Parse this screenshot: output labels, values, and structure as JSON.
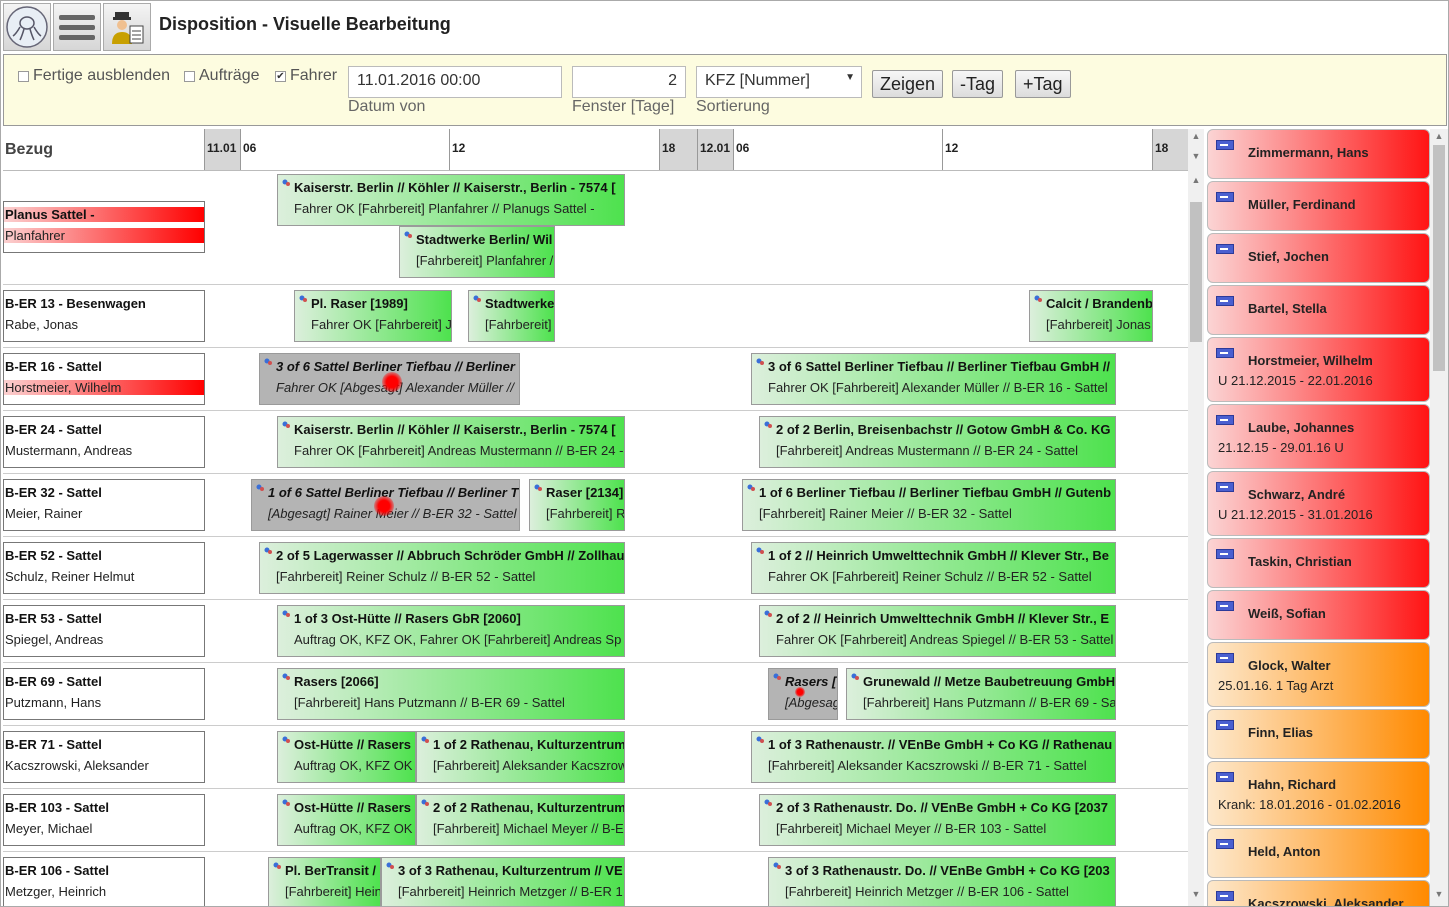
{
  "header": {
    "title": "Disposition - Visuelle Bearbeitung"
  },
  "toolbar": {
    "chk_fertige": "Fertige ausblenden",
    "chk_auftraege": "Aufträge",
    "chk_fahrer": "Fahrer",
    "datum_value": "11.01.2016 00:00",
    "datum_label": "Datum von",
    "fenster_value": "2",
    "fenster_label": "Fenster [Tage]",
    "sort_value": "KFZ [Nummer]",
    "sort_label": "Sortierung",
    "zeigen": "Zeigen",
    "minus_tag": "-Tag",
    "plus_tag": "+Tag"
  },
  "timeline": {
    "bezug": "Bezug",
    "ticks": [
      "11.01",
      "06",
      "12",
      "18",
      "12.01",
      "06",
      "12",
      "18"
    ]
  },
  "rows": [
    {
      "l1": "Planus Sattel -",
      "l2": "Planfahrer",
      "red": true
    },
    {
      "l1": "B-ER 13 - Besenwagen",
      "l2": "Rabe, Jonas"
    },
    {
      "l1": "B-ER 16 - Sattel",
      "l2": "Horstmeier, Wilhelm",
      "red2": true
    },
    {
      "l1": "B-ER 24 - Sattel",
      "l2": "Mustermann, Andreas"
    },
    {
      "l1": "B-ER 32 - Sattel",
      "l2": "Meier, Rainer"
    },
    {
      "l1": "B-ER 52 - Sattel",
      "l2": "Schulz, Reiner Helmut"
    },
    {
      "l1": "B-ER 53 - Sattel",
      "l2": "Spiegel, Andreas"
    },
    {
      "l1": "B-ER 69 - Sattel",
      "l2": "Putzmann, Hans"
    },
    {
      "l1": "B-ER 71 - Sattel",
      "l2": "Kacszrowski, Aleksander"
    },
    {
      "l1": "B-ER 103 - Sattel",
      "l2": "Meyer, Michael"
    },
    {
      "l1": "B-ER 106 - Sattel",
      "l2": "Metzger, Heinrich"
    }
  ],
  "bookings": [
    {
      "t1": "Kaiserstr. Berlin // Köhler // Kaiserstr., Berlin - 7574 [",
      "t2": "Fahrer OK [Fahrbereit] Planfahrer // Planugs Sattel -"
    },
    {
      "t1": "Stadtwerke Berlin/ Wil",
      "t2": "[Fahrbereit] Planfahrer /"
    },
    {
      "t1": "Pl. Raser [1989]",
      "t2": "Fahrer OK [Fahrbereit] J"
    },
    {
      "t1": "Stadtwerke",
      "t2": "[Fahrbereit]"
    },
    {
      "t1": "Calcit / Brandenb",
      "t2": "[Fahrbereit] Jonas"
    },
    {
      "t1": "3 of 6 Sattel Berliner Tiefbau // Berliner",
      "t2": "Fahrer OK [Abgesagt] Alexander Müller //"
    },
    {
      "t1": "3 of 6 Sattel Berliner Tiefbau // Berliner Tiefbau GmbH //",
      "t2": "Fahrer OK [Fahrbereit] Alexander Müller // B-ER 16 - Sattel"
    },
    {
      "t1": "Kaiserstr. Berlin // Köhler // Kaiserstr., Berlin - 7574 [",
      "t2": "Fahrer OK [Fahrbereit] Andreas Mustermann // B-ER 24 -"
    },
    {
      "t1": "2 of 2 Berlin, Breisenbachstr // Gotow GmbH & Co. KG",
      "t2": "[Fahrbereit] Andreas Mustermann // B-ER 24 - Sattel"
    },
    {
      "t1": "1 of 6 Sattel Berliner Tiefbau // Berliner T",
      "t2": "[Abgesagt] Rainer Meier // B-ER 32 - Sattel"
    },
    {
      "t1": "Raser [2134]",
      "t2": "[Fahrbereit] R"
    },
    {
      "t1": "1 of 6 Berliner Tiefbau // Berliner Tiefbau GmbH // Gutenb",
      "t2": "[Fahrbereit] Rainer Meier // B-ER 32 - Sattel"
    },
    {
      "t1": "2 of 5 Lagerwasser // Abbruch Schröder GmbH // Zollhau",
      "t2": "[Fahrbereit] Reiner Schulz // B-ER 52 - Sattel"
    },
    {
      "t1": "1 of 2 // Heinrich Umwelttechnik GmbH // Klever Str., Be",
      "t2": "Fahrer OK [Fahrbereit] Reiner Schulz // B-ER 52 - Sattel"
    },
    {
      "t1": "1 of 3 Ost-Hütte // Rasers GbR [2060]",
      "t2": "Auftrag OK, KFZ OK, Fahrer OK [Fahrbereit] Andreas Sp"
    },
    {
      "t1": "2 of 2 // Heinrich Umwelttechnik GmbH // Klever Str., E",
      "t2": "Fahrer OK [Fahrbereit] Andreas Spiegel // B-ER 53 - Sattel"
    },
    {
      "t1": "Rasers [2066]",
      "t2": "[Fahrbereit] Hans Putzmann // B-ER 69 - Sattel"
    },
    {
      "t1": "Rasers [",
      "t2": "[Abgesag"
    },
    {
      "t1": "Grunewald // Metze Baubetreuung GmbH",
      "t2": "[Fahrbereit] Hans Putzmann // B-ER 69 - Sa"
    },
    {
      "t1": "Ost-Hütte // Rasers",
      "t2": "Auftrag OK, KFZ OK"
    },
    {
      "t1": "1 of 2 Rathenau, Kulturzentrum",
      "t2": "[Fahrbereit] Aleksander Kacszrow"
    },
    {
      "t1": "1 of 3 Rathenaustr. // VEnBe GmbH + Co KG // Rathenau",
      "t2": "[Fahrbereit] Aleksander Kacszrowski // B-ER 71 - Sattel"
    },
    {
      "t1": "Ost-Hütte // Rasers",
      "t2": "Auftrag OK, KFZ OK"
    },
    {
      "t1": "2 of 2 Rathenau, Kulturzentrum",
      "t2": "[Fahrbereit] Michael Meyer // B-E"
    },
    {
      "t1": "2 of 3 Rathenaustr. Do. // VEnBe GmbH + Co KG [2037",
      "t2": "[Fahrbereit] Michael Meyer // B-ER 103 - Sattel"
    },
    {
      "t1": "Pl. BerTransit /",
      "t2": "[Fahrbereit] Hein"
    },
    {
      "t1": "3 of 3 Rathenau, Kulturzentrum // VE",
      "t2": "[Fahrbereit] Heinrich Metzger // B-ER 1"
    },
    {
      "t1": "3 of 3 Rathenaustr. Do. // VEnBe GmbH + Co KG [203",
      "t2": "[Fahrbereit] Heinrich Metzger // B-ER 106 - Sattel"
    }
  ],
  "drivers": [
    {
      "name": "Zimmermann, Hans",
      "sub": "",
      "tone": "r"
    },
    {
      "name": "Müller, Ferdinand",
      "sub": "",
      "tone": "r"
    },
    {
      "name": "Stief, Jochen",
      "sub": "",
      "tone": "r"
    },
    {
      "name": "Bartel, Stella",
      "sub": "",
      "tone": "r"
    },
    {
      "name": "Horstmeier, Wilhelm",
      "sub": "U 21.12.2015 - 22.01.2016",
      "tone": "r"
    },
    {
      "name": "Laube, Johannes",
      "sub": "21.12.15 - 29.01.16 U",
      "tone": "r"
    },
    {
      "name": "Schwarz, André",
      "sub": "U 21.12.2015 - 31.01.2016",
      "tone": "r"
    },
    {
      "name": "Taskin, Christian",
      "sub": "",
      "tone": "r"
    },
    {
      "name": "Weiß, Sofian",
      "sub": "",
      "tone": "r"
    },
    {
      "name": "Glock, Walter",
      "sub": "25.01.16. 1 Tag Arzt",
      "tone": "o"
    },
    {
      "name": "Finn, Elias",
      "sub": "",
      "tone": "o"
    },
    {
      "name": "Hahn, Richard",
      "sub": "Krank: 18.01.2016 - 01.02.2016",
      "tone": "o"
    },
    {
      "name": "Held, Anton",
      "sub": "",
      "tone": "o"
    },
    {
      "name": "Kacszrowski, Aleksander",
      "sub": "",
      "tone": "o"
    }
  ]
}
